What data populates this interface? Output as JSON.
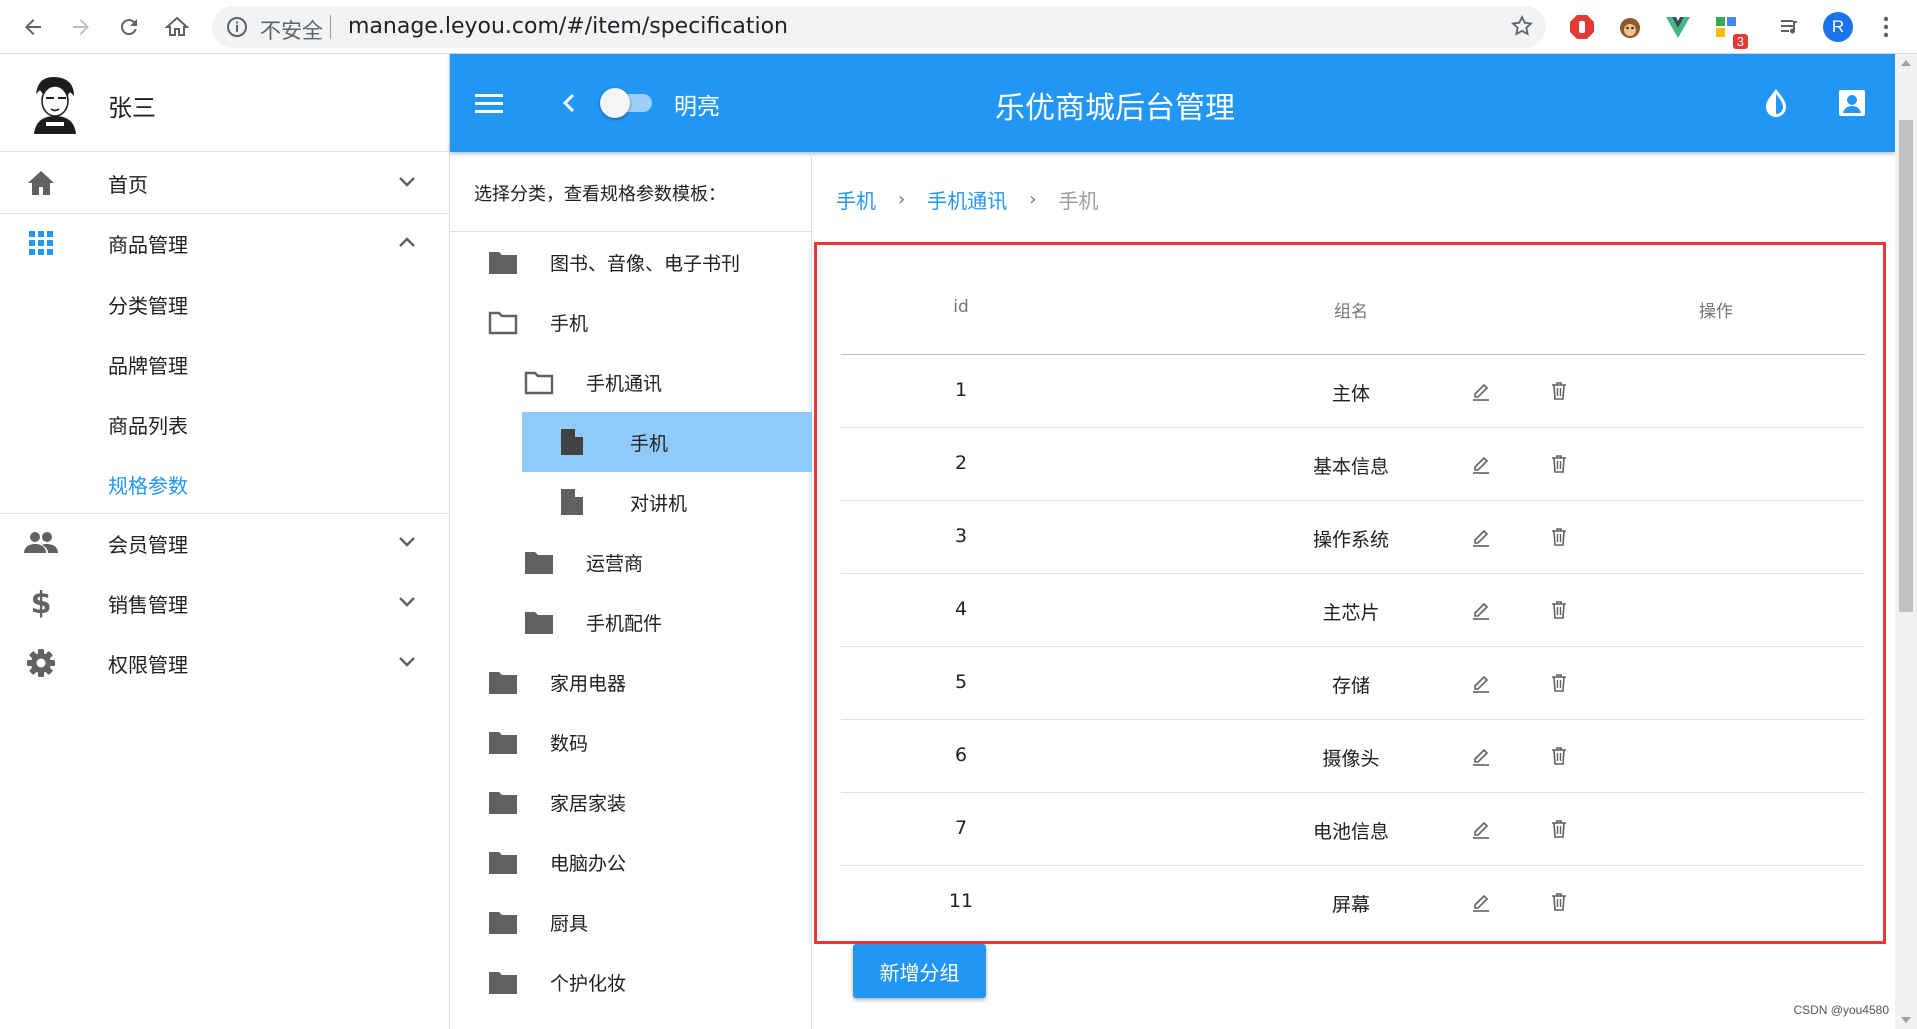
{
  "browser": {
    "insecure_label": "不安全",
    "url": "manage.leyou.com/#/item/specification",
    "profile_initial": "R",
    "extension_badge": "3"
  },
  "user": {
    "name": "张三"
  },
  "sidebar": {
    "items": [
      {
        "label": "首页",
        "icon": "home-icon",
        "expanded": false
      },
      {
        "label": "商品管理",
        "icon": "grid-apps-icon",
        "expanded": true,
        "children": [
          {
            "label": "分类管理",
            "active": false
          },
          {
            "label": "品牌管理",
            "active": false
          },
          {
            "label": "商品列表",
            "active": false
          },
          {
            "label": "规格参数",
            "active": true
          }
        ]
      },
      {
        "label": "会员管理",
        "icon": "people-icon",
        "expanded": false
      },
      {
        "label": "销售管理",
        "icon": "dollar-icon",
        "expanded": false
      },
      {
        "label": "权限管理",
        "icon": "gear-icon",
        "expanded": false
      }
    ]
  },
  "toolbar": {
    "mode_label": "明亮",
    "title": "乐优商城后台管理"
  },
  "tree": {
    "heading": "选择分类，查看规格参数模板：",
    "nodes": [
      {
        "label": "图书、音像、电子书刊",
        "level": 0,
        "type": "folder"
      },
      {
        "label": "手机",
        "level": 0,
        "type": "folder-open"
      },
      {
        "label": "手机通讯",
        "level": 1,
        "type": "folder-open"
      },
      {
        "label": "手机",
        "level": 2,
        "type": "file",
        "selected": true
      },
      {
        "label": "对讲机",
        "level": 2,
        "type": "file"
      },
      {
        "label": "运营商",
        "level": 1,
        "type": "folder"
      },
      {
        "label": "手机配件",
        "level": 1,
        "type": "folder"
      },
      {
        "label": "家用电器",
        "level": 0,
        "type": "folder"
      },
      {
        "label": "数码",
        "level": 0,
        "type": "folder"
      },
      {
        "label": "家居家装",
        "level": 0,
        "type": "folder"
      },
      {
        "label": "电脑办公",
        "level": 0,
        "type": "folder"
      },
      {
        "label": "厨具",
        "level": 0,
        "type": "folder"
      },
      {
        "label": "个护化妆",
        "level": 0,
        "type": "folder"
      }
    ]
  },
  "breadcrumb": [
    "手机",
    "手机通讯",
    "手机"
  ],
  "table": {
    "headers": {
      "id": "id",
      "name": "组名",
      "actions": "操作"
    },
    "rows": [
      {
        "id": "1",
        "name": "主体"
      },
      {
        "id": "2",
        "name": "基本信息"
      },
      {
        "id": "3",
        "name": "操作系统"
      },
      {
        "id": "4",
        "name": "主芯片"
      },
      {
        "id": "5",
        "name": "存储"
      },
      {
        "id": "6",
        "name": "摄像头"
      },
      {
        "id": "7",
        "name": "电池信息"
      },
      {
        "id": "11",
        "name": "屏幕"
      }
    ]
  },
  "add_group_button": "新增分组",
  "watermark": "CSDN @you4580",
  "colors": {
    "primary": "#2196f3",
    "selected_node": "#90caf9",
    "highlight_border": "#e53935"
  }
}
